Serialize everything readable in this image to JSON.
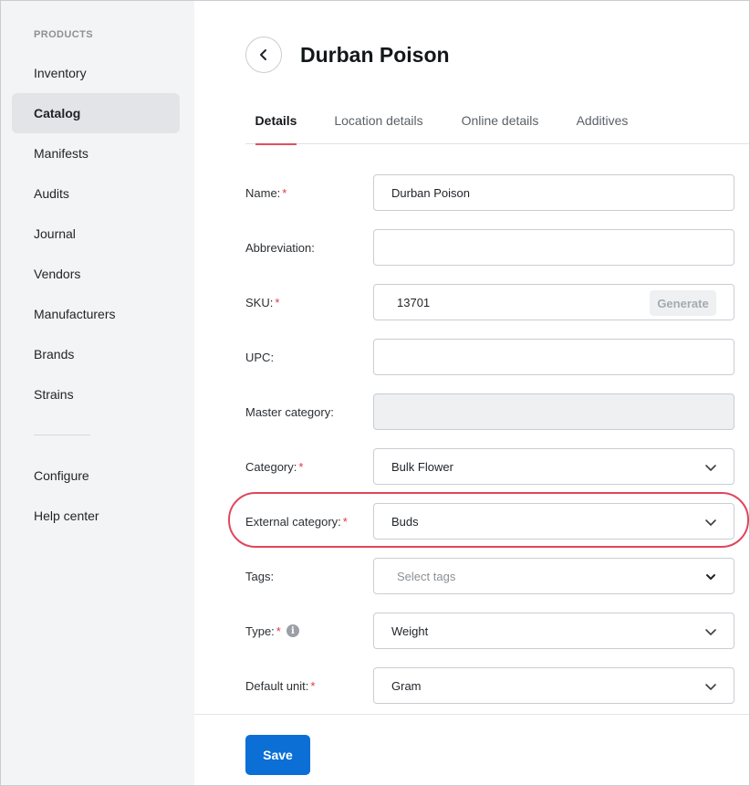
{
  "sidebar": {
    "section_label": "PRODUCTS",
    "items": [
      {
        "label": "Inventory"
      },
      {
        "label": "Catalog",
        "active": true
      },
      {
        "label": "Manifests"
      },
      {
        "label": "Audits"
      },
      {
        "label": "Journal"
      },
      {
        "label": "Vendors"
      },
      {
        "label": "Manufacturers"
      },
      {
        "label": "Brands"
      },
      {
        "label": "Strains"
      }
    ],
    "secondary_items": [
      {
        "label": "Configure"
      },
      {
        "label": "Help center"
      }
    ]
  },
  "header": {
    "back_icon": "chevron-left-icon",
    "title": "Durban Poison"
  },
  "tabs": [
    {
      "label": "Details",
      "active": true
    },
    {
      "label": "Location details"
    },
    {
      "label": "Online details"
    },
    {
      "label": "Additives"
    }
  ],
  "form": {
    "name": {
      "label": "Name:",
      "required": "*",
      "value": "Durban Poison"
    },
    "abbreviation": {
      "label": "Abbreviation:",
      "value": ""
    },
    "sku": {
      "label": "SKU:",
      "required": "*",
      "value": "13701",
      "generate_label": "Generate"
    },
    "upc": {
      "label": "UPC:",
      "value": ""
    },
    "master_category": {
      "label": "Master category:",
      "value": ""
    },
    "category": {
      "label": "Category:",
      "required": "*",
      "value": "Bulk Flower"
    },
    "external_category": {
      "label": "External category:",
      "required": "*",
      "value": "Buds"
    },
    "tags": {
      "label": "Tags:",
      "placeholder": "Select tags"
    },
    "type": {
      "label": "Type:",
      "required": "*",
      "info_icon": "i",
      "value": "Weight"
    },
    "default_unit": {
      "label": "Default unit:",
      "required": "*",
      "value": "Gram"
    }
  },
  "footer": {
    "save_label": "Save"
  },
  "colors": {
    "accent_blue": "#0b6fd6",
    "required_red": "#e0364a",
    "highlight_ring": "#e0455a",
    "active_tab_underline": "#e44d5e"
  }
}
